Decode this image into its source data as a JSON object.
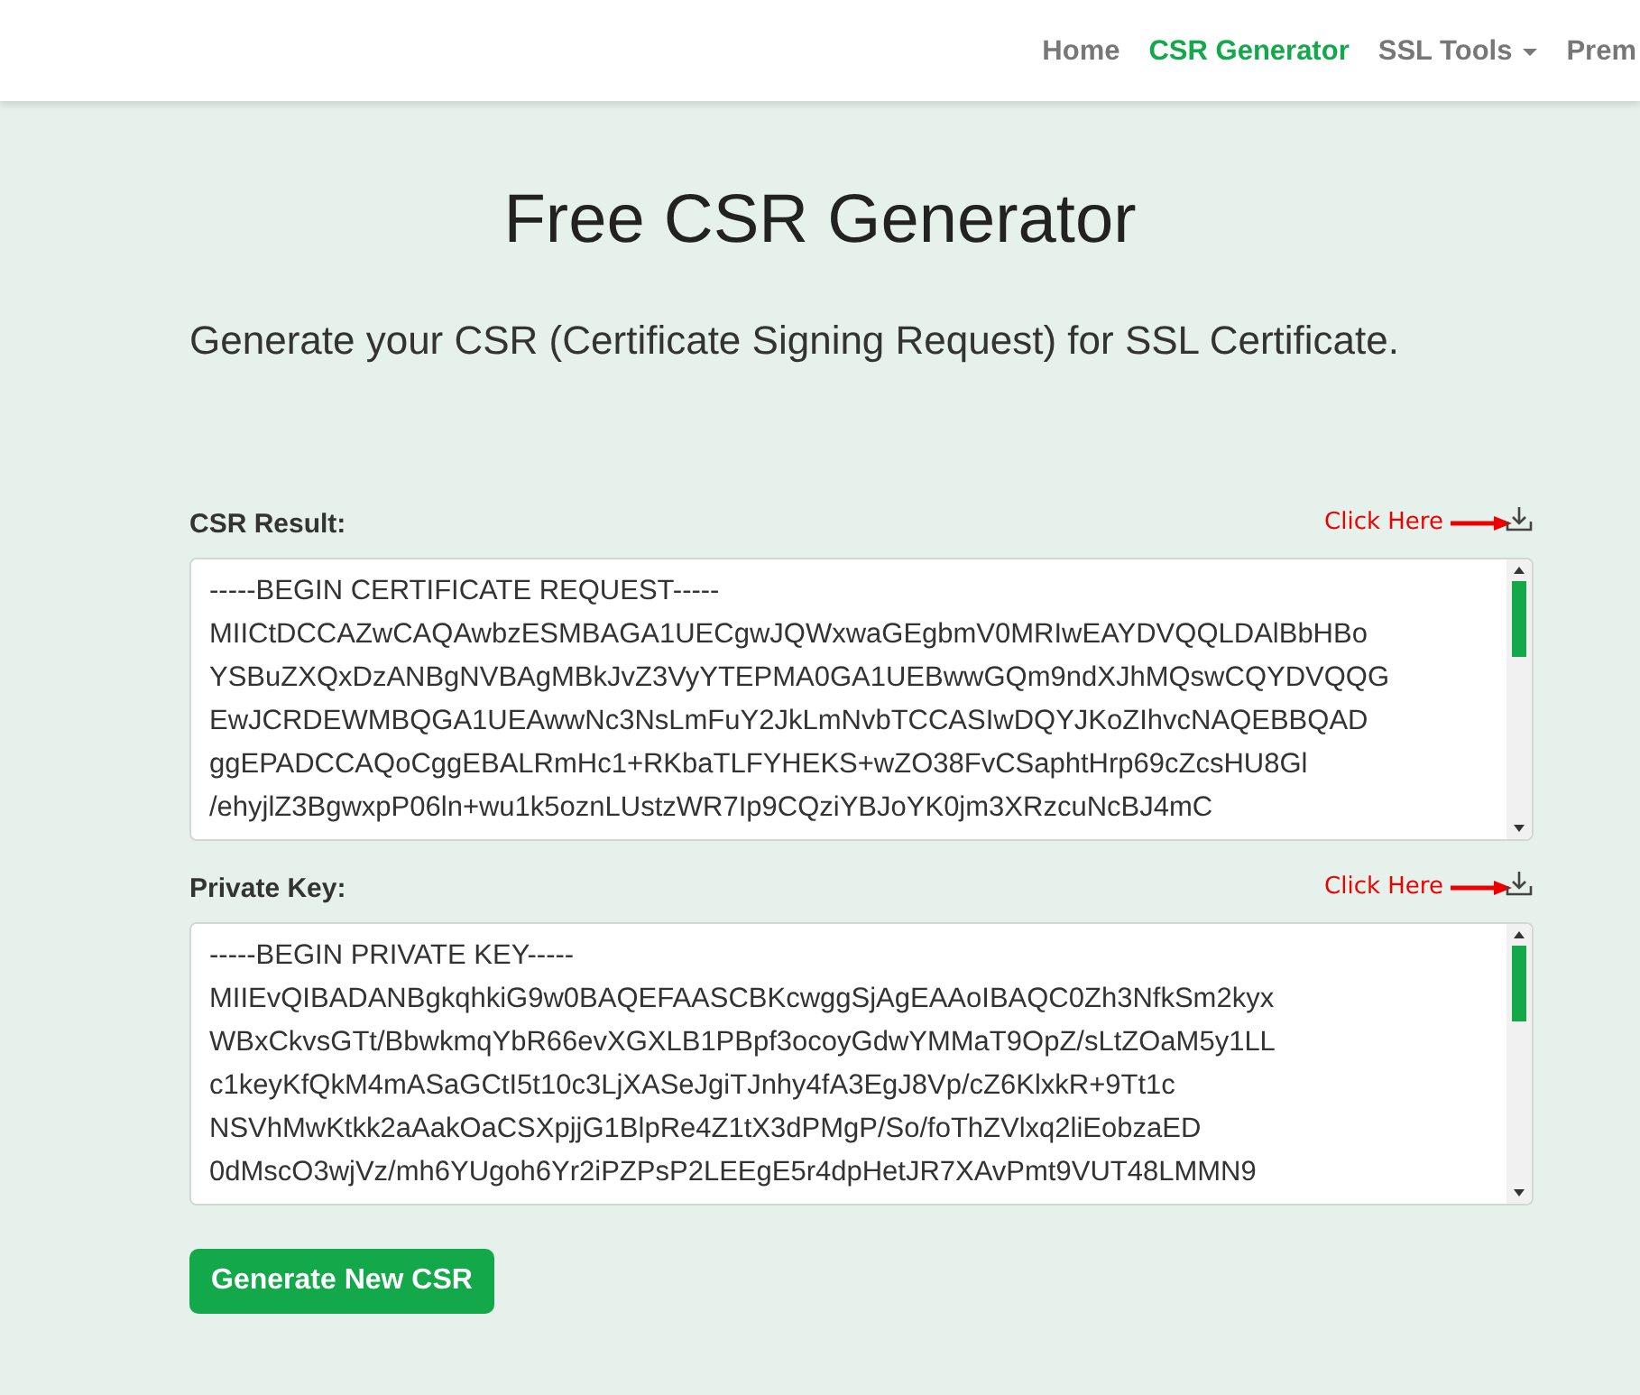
{
  "nav": {
    "items": [
      {
        "label": "Home",
        "selected": false,
        "dropdown": false
      },
      {
        "label": "CSR Generator",
        "selected": true,
        "dropdown": false
      },
      {
        "label": "SSL Tools",
        "selected": false,
        "dropdown": true
      },
      {
        "label": "Prem",
        "selected": false,
        "dropdown": false
      }
    ]
  },
  "title": "Free CSR Generator",
  "subtitle": "Generate your CSR (Certificate Signing Request) for SSL Certificate.",
  "fields": [
    {
      "label": "CSR Result:",
      "hint": "Click Here",
      "value": "-----BEGIN CERTIFICATE REQUEST-----\nMIICtDCCAZwCAQAwbzESMBAGA1UECgwJQWxwaGEgbmV0MRIwEAYDVQQLDAlBbHBo\nYSBuZXQxDzANBgNVBAgMBkJvZ3VyYTEPMA0GA1UEBwwGQm9ndXJhMQswCQYDVQQG\nEwJCRDEWMBQGA1UEAwwNc3NsLmFuY2JkLmNvbTCCASIwDQYJKoZIhvcNAQEBBQAD\nggEPADCCAQoCggEBALRmHc1+RKbaTLFYHEKS+wZO38FvCSaphtHrp69cZcsHU8Gl\n/ehyjlZ3BgwxpP06ln+wu1k5oznLUstzWR7Ip9CQziYBJoYK0jm3XRzcuNcBJ4mC"
    },
    {
      "label": "Private Key:",
      "hint": "Click Here",
      "value": "-----BEGIN PRIVATE KEY-----\nMIIEvQIBADANBgkqhkiG9w0BAQEFAASCBKcwggSjAgEAAoIBAQC0Zh3NfkSm2kyx\nWBxCkvsGTt/BbwkmqYbR66evXGXLB1PBpf3ocoyGdwYMMaT9OpZ/sLtZOaM5y1LL\nc1keyKfQkM4mASaGCtI5t10c3LjXASeJgiTJnhy4fA3EgJ8Vp/cZ6KlxkR+9Tt1c\nNSVhMwKtkk2aAakOaCSXpjjG1BlpRe4Z1tX3dPMgP/So/foThZVlxq2liEobzaED\n0dMscO3wjVz/mh6YUgoh6Yr2iPZPsP2LEEgE5r4dpHetJR7XAvPmt9VUT48LMMN9"
    }
  ],
  "button": "Generate New CSR"
}
